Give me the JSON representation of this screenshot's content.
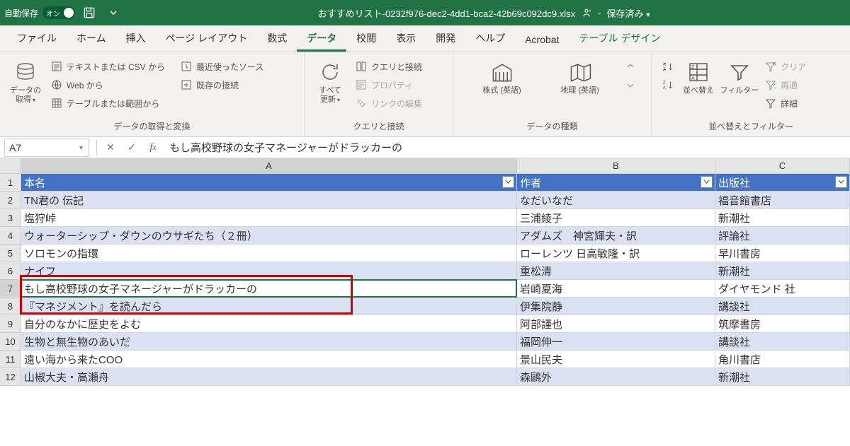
{
  "titlebar": {
    "autosave_label": "自動保存",
    "autosave_on": "オン",
    "filename": "おすすめリスト-0232f976-dec2-4dd1-bca2-42b69c092dc9.xlsx",
    "save_status": "保存済み"
  },
  "tabs": {
    "file": "ファイル",
    "home": "ホーム",
    "insert": "挿入",
    "page_layout": "ページ レイアウト",
    "formulas": "数式",
    "data": "データ",
    "review": "校閲",
    "view": "表示",
    "developer": "開発",
    "help": "ヘルプ",
    "acrobat": "Acrobat",
    "table_design": "テーブル デザイン"
  },
  "ribbon": {
    "group1": {
      "get_data": "データの\n取得",
      "from_text_csv": "テキストまたは CSV から",
      "from_web": "Web から",
      "from_table_range": "テーブルまたは範囲から",
      "recent_sources": "最近使ったソース",
      "existing_connections": "既存の接続",
      "label": "データの取得と変換"
    },
    "group2": {
      "refresh_all": "すべて\n更新",
      "queries_connections": "クエリと接続",
      "properties": "プロパティ",
      "edit_links": "リンクの編集",
      "label": "クエリと接続"
    },
    "group3": {
      "stocks": "株式 (英語)",
      "geography": "地理 (英語)",
      "label": "データの種類"
    },
    "group4": {
      "sort": "並べ替え",
      "filter": "フィルター",
      "clear": "クリア",
      "reapply": "再適",
      "advanced": "詳細",
      "label": "並べ替えとフィルター"
    }
  },
  "namebox": "A7",
  "formula": "もし高校野球の女子マネージャーがドラッカーの",
  "headers": {
    "A": "本名",
    "B": "作者",
    "C": "出版社"
  },
  "col_letters": {
    "A": "A",
    "B": "B",
    "C": "C"
  },
  "rows": [
    {
      "n": "2",
      "A": "TN君の 伝記",
      "B": "なだいなだ",
      "C": "福音館書店"
    },
    {
      "n": "3",
      "A": "塩狩峠",
      "B": "三浦綾子",
      "C": "新潮社"
    },
    {
      "n": "4",
      "A": "ウォーターシップ・ダウンのウサギたち（２冊）",
      "B": "アダムズ　神宮輝夫・訳",
      "C": "評論社"
    },
    {
      "n": "5",
      "A": "ソロモンの指環",
      "B": "ローレンツ  日高敏隆・訳",
      "C": "早川書房"
    },
    {
      "n": "6",
      "A": "ナイフ",
      "B": "重松清",
      "C": "新潮社"
    },
    {
      "n": "7",
      "A": "もし高校野球の女子マネージャーがドラッカーの",
      "B": "岩崎夏海",
      "C": "ダイヤモンド 社"
    },
    {
      "n": "8",
      "A": "『マネジメント』を読んだら",
      "B": "伊集院静",
      "C": "講談社"
    },
    {
      "n": "9",
      "A": "自分のなかに歴史をよむ",
      "B": "阿部謹也",
      "C": "筑摩書房"
    },
    {
      "n": "10",
      "A": "生物と無生物のあいだ",
      "B": "福岡伸一",
      "C": "講談社"
    },
    {
      "n": "11",
      "A": "遠い海から来たCOO",
      "B": "景山民夫",
      "C": "角川書店"
    },
    {
      "n": "12",
      "A": "山椒大夫・高瀬舟",
      "B": "森鷗外",
      "C": "新潮社"
    }
  ]
}
